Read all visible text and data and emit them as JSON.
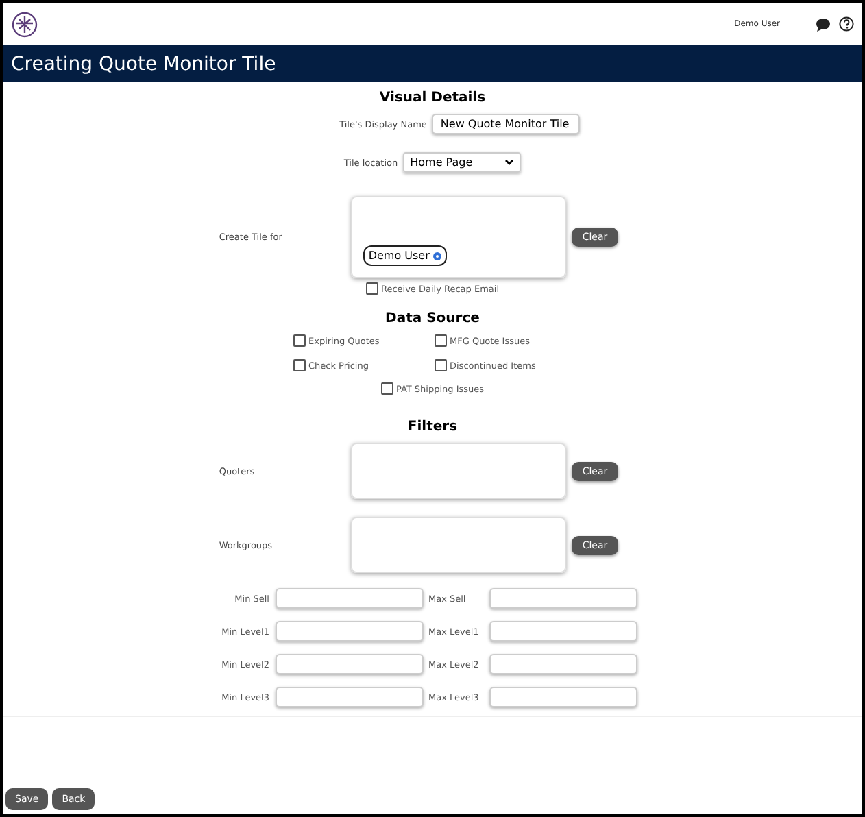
{
  "header": {
    "user": "Demo User"
  },
  "title": "Creating Quote Monitor Tile",
  "visual_details": {
    "heading": "Visual Details",
    "display_name": {
      "label": "Tile's Display Name",
      "value": "New Quote Monitor Tile"
    },
    "location": {
      "label": "Tile location",
      "value": "Home Page"
    },
    "create_for": {
      "label": "Create Tile for",
      "chips": [
        "Demo User"
      ],
      "clear": "Clear"
    },
    "recap": {
      "label": "Receive Daily Recap Email",
      "checked": false
    }
  },
  "data_source": {
    "heading": "Data Source",
    "options": [
      {
        "label": "Expiring Quotes",
        "checked": false
      },
      {
        "label": "MFG Quote Issues",
        "checked": false
      },
      {
        "label": "Check Pricing",
        "checked": false
      },
      {
        "label": "Discontinued Items",
        "checked": false
      },
      {
        "label": "PAT Shipping Issues",
        "checked": false
      }
    ]
  },
  "filters": {
    "heading": "Filters",
    "lists": [
      {
        "label": "Quoters",
        "clear": "Clear"
      },
      {
        "label": "Workgroups",
        "clear": "Clear"
      }
    ],
    "ranges": [
      {
        "min": "Min Sell",
        "max": "Max Sell"
      },
      {
        "min": "Min Level1",
        "max": "Max Level1"
      },
      {
        "min": "Min Level2",
        "max": "Max Level2"
      },
      {
        "min": "Min Level3",
        "max": "Max Level3"
      }
    ]
  },
  "buttons": [
    "Save",
    "Back"
  ]
}
